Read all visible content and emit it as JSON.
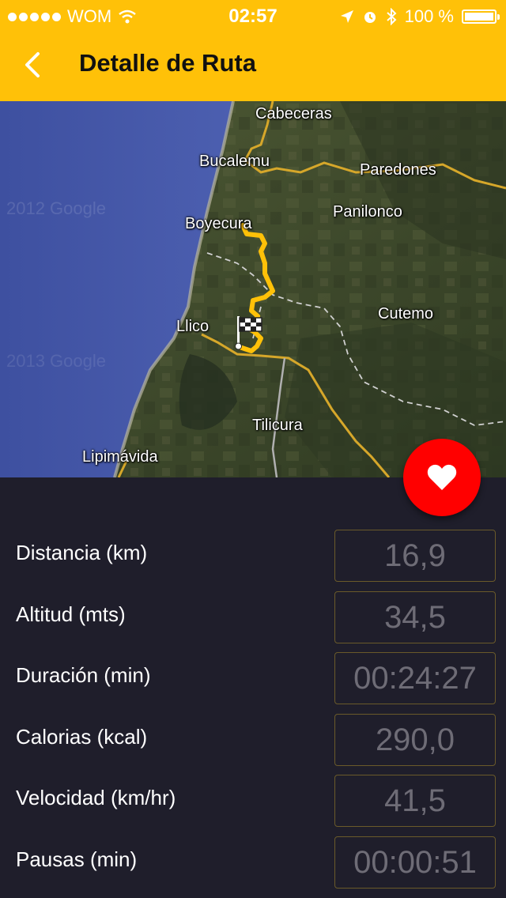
{
  "status_bar": {
    "carrier": "WOM",
    "time": "02:57",
    "battery": "100 %"
  },
  "nav": {
    "title": "Detalle de Ruta"
  },
  "map": {
    "places": [
      "Cabeceras",
      "Bucalemu",
      "Paredones",
      "Panilonco",
      "Boyecura",
      "Cutemo",
      "Llico",
      "Tilicura",
      "Lipimávida"
    ],
    "watermark": "2012 Google",
    "watermark_2": "2013 Google",
    "route_color": "#ffc108"
  },
  "stats": [
    {
      "label": "Distancia (km)",
      "value": "16,9"
    },
    {
      "label": "Altitud (mts)",
      "value": "34,5"
    },
    {
      "label": "Duración (min)",
      "value": "00:24:27"
    },
    {
      "label": "Calorias (kcal)",
      "value": "290,0"
    },
    {
      "label": "Velocidad (km/hr)",
      "value": "41,5"
    },
    {
      "label": "Pausas (min)",
      "value": "00:00:51"
    }
  ],
  "colors": {
    "accent": "#ffc108",
    "background": "#1f1e2b",
    "favorite": "#ff0000"
  }
}
